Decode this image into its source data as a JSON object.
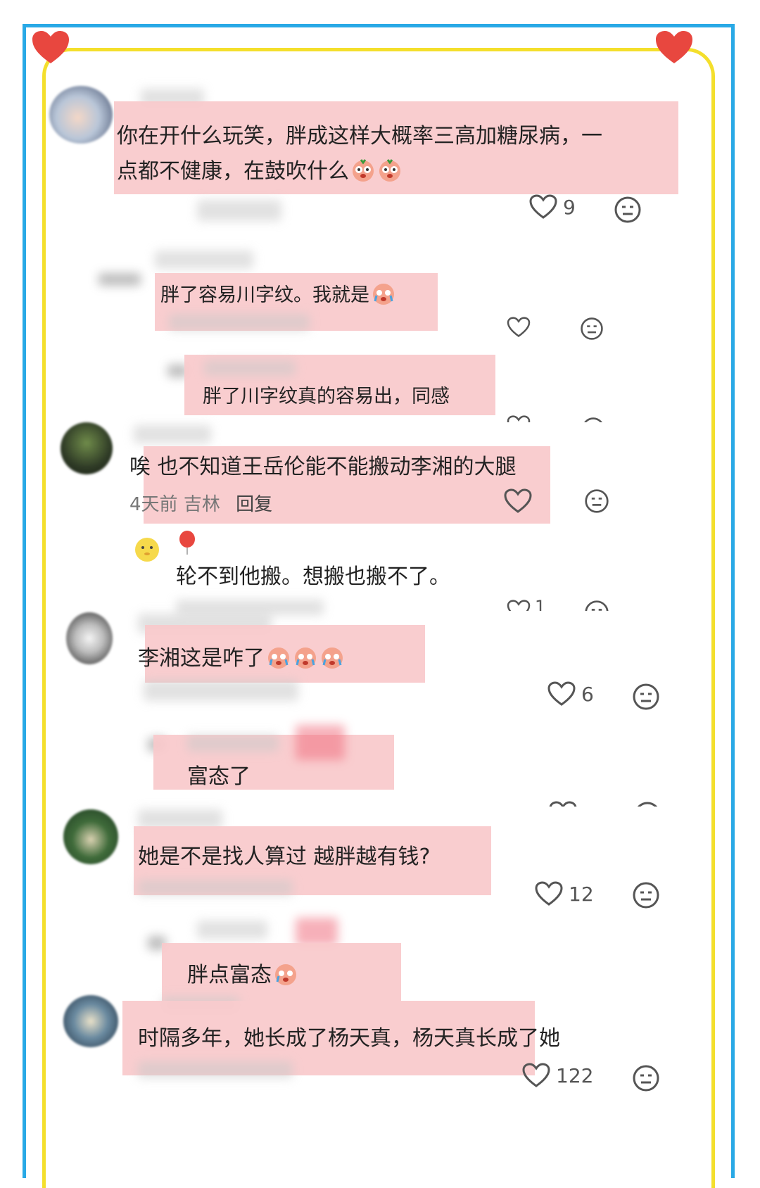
{
  "colors": {
    "outer_border": "#29a9e6",
    "inner_border": "#f4df2c",
    "highlight": "#f8c9cb",
    "heart": "#e8473f"
  },
  "comments": [
    {
      "text_line1": "你在开什么玩笑，胖成这样大概率三高加糖尿病，一",
      "text_line2": "点都不健康，在鼓吹什么",
      "likes": "9"
    },
    {
      "text": "胖了容易川字纹。我就是",
      "likes": ""
    },
    {
      "text": "胖了川字纹真的容易出，同感"
    },
    {
      "text": "唉 也不知道王岳伦能不能搬动李湘的大腿",
      "meta_time": "4天前",
      "meta_location": "吉林",
      "meta_reply": "回复"
    },
    {
      "text": "轮不到他搬。想搬也搬不了。",
      "likes": "1"
    },
    {
      "text": "李湘这是咋了",
      "likes": "6"
    },
    {
      "text": "富态了"
    },
    {
      "text": "她是不是找人算过 越胖越有钱?",
      "likes": "12"
    },
    {
      "text": "胖点富态"
    },
    {
      "text": "时隔多年，她长成了杨天真，杨天真长成了她",
      "likes": "122"
    }
  ]
}
